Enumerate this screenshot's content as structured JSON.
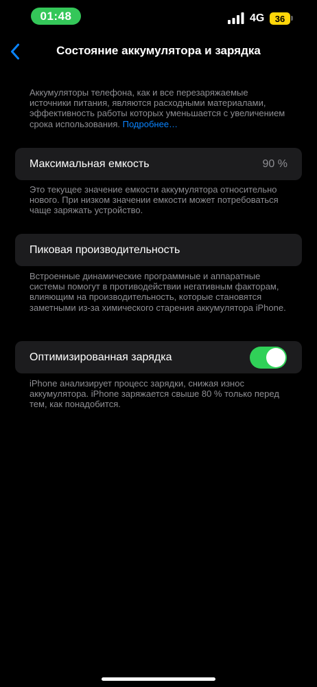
{
  "status_bar": {
    "time": "01:48",
    "network": "4G",
    "battery_level": "36",
    "colors": {
      "time_pill": "#34c759",
      "battery": "#ffd60a"
    }
  },
  "nav": {
    "back_icon": "chevron-left-icon",
    "title": "Состояние аккумулятора и зарядка"
  },
  "intro": {
    "text": "Аккумуляторы телефона, как и все перезаряжаемые источники питания, являются расходными материалами, эффективность работы которых уменьшается с увеличением срока использования. ",
    "link": "Подробнее…"
  },
  "max_capacity": {
    "label": "Максимальная емкость",
    "value": "90 %",
    "footer": "Это текущее значение емкости аккумулятора относительно нового. При низком значении емкости может потребоваться чаще заряжать устройство."
  },
  "peak_performance": {
    "label": "Пиковая производительность",
    "footer": "Встроенные динамические программные и аппаратные системы помогут в противодействии негативным факторам, влияющим на производительность, которые становятся заметными из-за химического старения аккумулятора iPhone."
  },
  "optimized_charging": {
    "label": "Оптимизированная зарядка",
    "enabled": true,
    "footer": "iPhone анализирует процесс зарядки, снижая износ аккумулятора. iPhone заряжается свыше 80 % только перед тем, как понадобится."
  },
  "accent_colors": {
    "link": "#0a84ff",
    "toggle_on": "#30d158"
  }
}
